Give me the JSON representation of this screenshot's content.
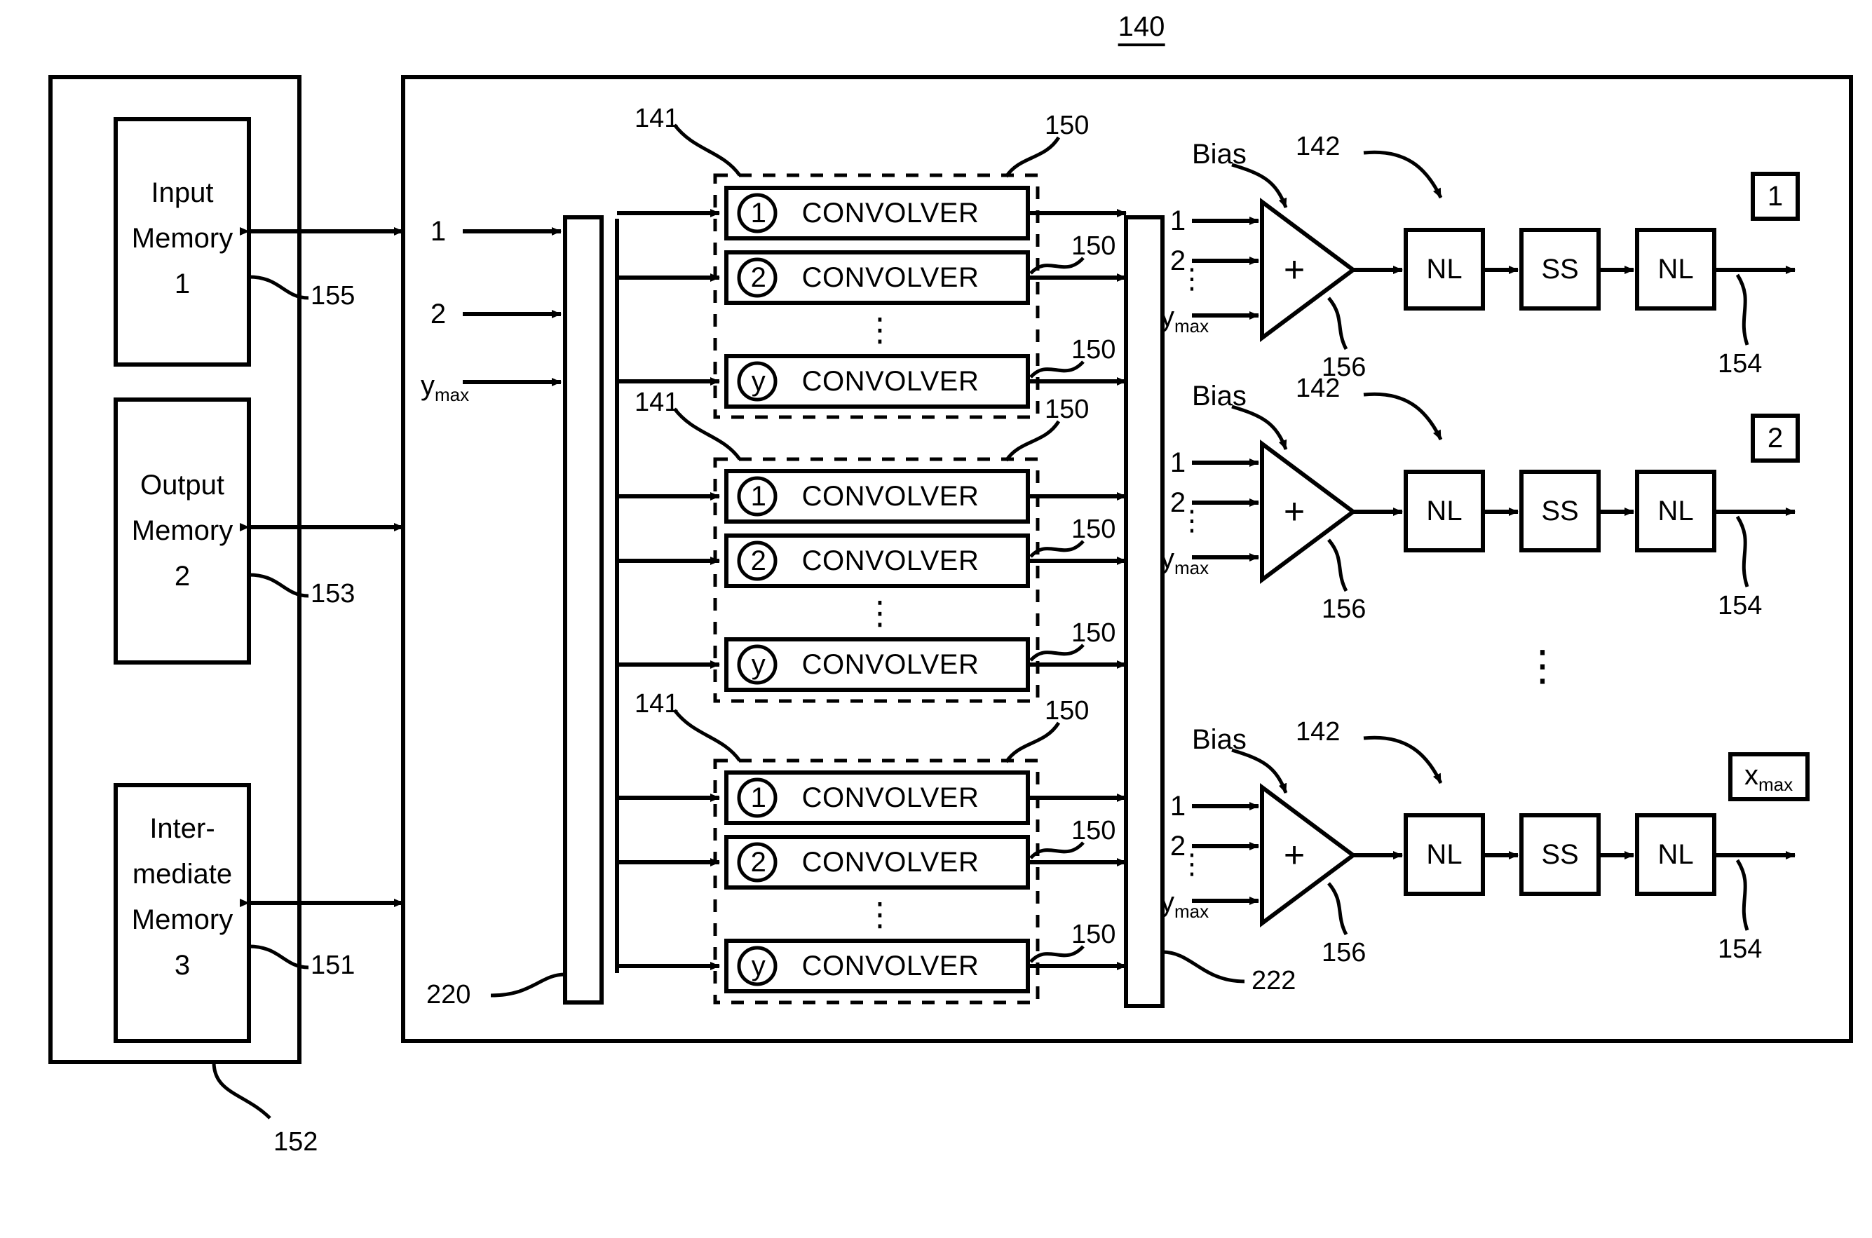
{
  "figure": {
    "number": "140",
    "title_ref": "140"
  },
  "memory_block": {
    "ref": "152",
    "items": [
      {
        "name": "Input Memory",
        "line1": "Input",
        "line2": "Memory",
        "index": "1",
        "ref": "155"
      },
      {
        "name": "Output Memory",
        "line1": "Output",
        "line2": "Memory",
        "index": "2",
        "ref": "153"
      },
      {
        "name": "Intermediate Memory",
        "line1": "Inter-",
        "line2": "mediate",
        "line3": "Memory",
        "index": "3",
        "ref": "151"
      }
    ]
  },
  "input_bus": {
    "ref": "220",
    "labels": [
      "1",
      "2",
      "ymax"
    ],
    "ymax_base": "y",
    "ymax_sub": "max"
  },
  "output_bus": {
    "ref": "222"
  },
  "convolver_groups": [
    {
      "group_ref": "141",
      "rows": [
        {
          "id": "1",
          "label": "CONVOLVER",
          "out_ref": "150"
        },
        {
          "id": "2",
          "label": "CONVOLVER",
          "out_ref": "150"
        },
        {
          "id": "y",
          "label": "CONVOLVER",
          "out_ref": "150"
        }
      ],
      "ellipsis": "⋮"
    },
    {
      "group_ref": "141",
      "rows": [
        {
          "id": "1",
          "label": "CONVOLVER",
          "out_ref": "150"
        },
        {
          "id": "2",
          "label": "CONVOLVER",
          "out_ref": "150"
        },
        {
          "id": "y",
          "label": "CONVOLVER",
          "out_ref": "150"
        }
      ],
      "ellipsis": "⋮"
    },
    {
      "group_ref": "141",
      "rows": [
        {
          "id": "1",
          "label": "CONVOLVER",
          "out_ref": "150"
        },
        {
          "id": "2",
          "label": "CONVOLVER",
          "out_ref": "150"
        },
        {
          "id": "y",
          "label": "CONVOLVER",
          "out_ref": "150"
        }
      ],
      "ellipsis": "⋮"
    }
  ],
  "channels": [
    {
      "bias_label": "Bias",
      "adder_symbol": "+",
      "adder_ref": "156",
      "chain_ref": "142",
      "output_ref": "154",
      "inputs": [
        "1",
        "2",
        "ymax"
      ],
      "stages": [
        "NL",
        "SS",
        "NL"
      ],
      "output_box": "1"
    },
    {
      "bias_label": "Bias",
      "adder_symbol": "+",
      "adder_ref": "156",
      "chain_ref": "142",
      "output_ref": "154",
      "inputs": [
        "1",
        "2",
        "ymax"
      ],
      "stages": [
        "NL",
        "SS",
        "NL"
      ],
      "output_box": "2"
    },
    {
      "bias_label": "Bias",
      "adder_symbol": "+",
      "adder_ref": "156",
      "chain_ref": "142",
      "output_ref": "154",
      "inputs": [
        "1",
        "2",
        "ymax"
      ],
      "stages": [
        "NL",
        "SS",
        "NL"
      ],
      "output_box_base": "x",
      "output_box_sub": "max"
    }
  ],
  "channel_ellipsis": "⋮",
  "colors": {
    "stroke": "#000000",
    "background": "#ffffff"
  }
}
